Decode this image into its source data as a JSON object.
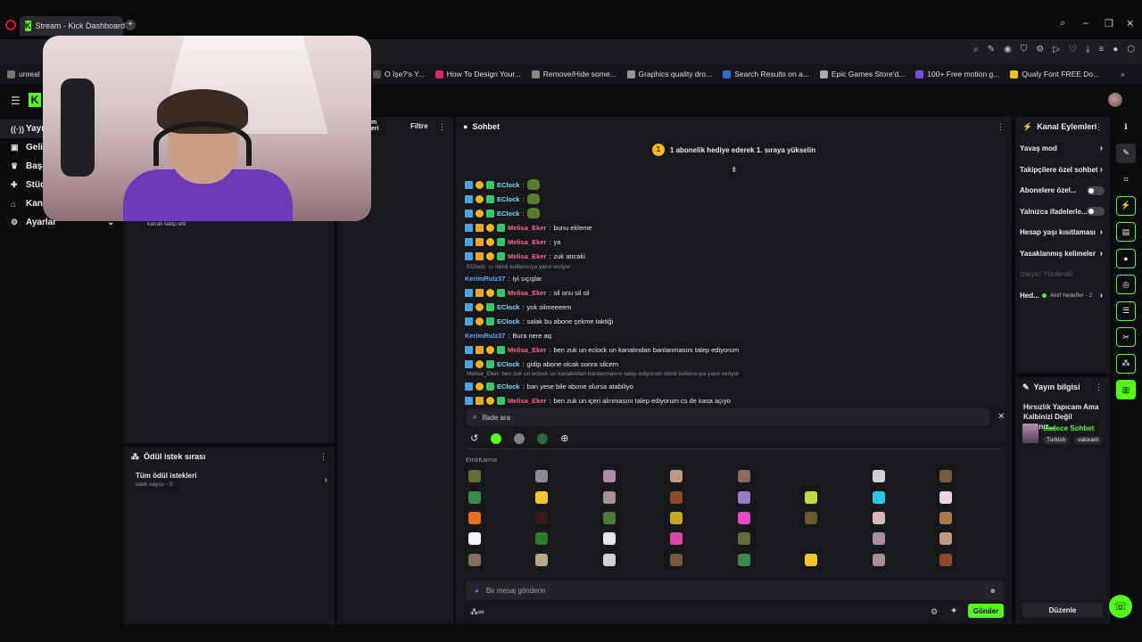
{
  "browser": {
    "tab_title": "Stream - Kick Dashboard",
    "bookmarks_left": "unreal",
    "bookmarks": [
      {
        "label": "O İşe?'s Y...",
        "color": "#555"
      },
      {
        "label": "How To Design Your...",
        "color": "#e0245e"
      },
      {
        "label": "Remove/Hide some...",
        "color": "#888"
      },
      {
        "label": "Graphics quality dro...",
        "color": "#999"
      },
      {
        "label": "Search Results on a...",
        "color": "#2a6fd6"
      },
      {
        "label": "Epic Games Store'd...",
        "color": "#aaa"
      },
      {
        "label": "100+ Free motion g...",
        "color": "#7b4ae2"
      },
      {
        "label": "Qualy Font FREE Do...",
        "color": "#f2c400"
      }
    ]
  },
  "nav": {
    "items": [
      "Yayın",
      "Gelir",
      "Başa",
      "Stüd",
      "Kanal",
      "Ayarlar"
    ]
  },
  "panels": {
    "left_stub_header": "m\neri",
    "filter_label": "Filtre",
    "follow_text": "kanalı takip etti",
    "reward_queue_title": "Ödül istek sırası",
    "reward_all_title": "Tüm ödül istekleri",
    "reward_all_sub": "istek sayısı - 0"
  },
  "chat": {
    "title": "Sohbet",
    "promo_count": "1",
    "promo_text": "1 abonelik hediye ederek 1. sıraya yükselin",
    "messages": [
      {
        "kind": "msg",
        "badges": [
          "b",
          "y",
          "g"
        ],
        "user": "EClock",
        "color": "#7ad7ff",
        "text": "",
        "emote": true
      },
      {
        "kind": "msg",
        "badges": [
          "b",
          "y",
          "g"
        ],
        "user": "EClock",
        "color": "#7ad7ff",
        "text": "",
        "emote": true
      },
      {
        "kind": "msg",
        "badges": [
          "b",
          "y",
          "g"
        ],
        "user": "EClock",
        "color": "#7ad7ff",
        "text": "",
        "emote": true
      },
      {
        "kind": "msg",
        "badges": [
          "b",
          "c",
          "y",
          "g"
        ],
        "user": "Melisa_Eker",
        "color": "#ff5f8f",
        "text": "bunu ekleme"
      },
      {
        "kind": "msg",
        "badges": [
          "b",
          "c",
          "y",
          "g"
        ],
        "user": "Melisa_Eker",
        "color": "#ff5f8f",
        "text": "ya"
      },
      {
        "kind": "msg",
        "badges": [
          "b",
          "c",
          "y",
          "g"
        ],
        "user": "Melisa_Eker",
        "color": "#ff5f8f",
        "text": "zuk atıcaki"
      },
      {
        "kind": "reply",
        "text": "EClock: ▭ isimli kullanıcıya yanıt veriyor"
      },
      {
        "kind": "msg",
        "badges": [],
        "user": "KerimRulz37",
        "color": "#5ea3ff",
        "text": "iyi sıçışlar"
      },
      {
        "kind": "msg",
        "badges": [
          "b",
          "c",
          "y",
          "g"
        ],
        "user": "Melisa_Eker",
        "color": "#ff5f8f",
        "text": "sil onu sil sil"
      },
      {
        "kind": "msg",
        "badges": [
          "b",
          "y",
          "g"
        ],
        "user": "EClock",
        "color": "#7ad7ff",
        "text": "yok silmeeeem"
      },
      {
        "kind": "msg",
        "badges": [
          "b",
          "y",
          "g"
        ],
        "user": "EClock",
        "color": "#7ad7ff",
        "text": "salak bu abone çekme taktiği"
      },
      {
        "kind": "msg",
        "badges": [],
        "user": "KerimRulz37",
        "color": "#5ea3ff",
        "text": "Bura nere aq"
      },
      {
        "kind": "msg",
        "badges": [
          "b",
          "c",
          "y",
          "g"
        ],
        "user": "Melisa_Eker",
        "color": "#ff5f8f",
        "text": "ben zuk un eclock un kanalından banlanmasını talep ediyorum"
      },
      {
        "kind": "msg",
        "badges": [
          "b",
          "y",
          "g"
        ],
        "user": "EClock",
        "color": "#7ad7ff",
        "text": "gidip abone olcak sonra silcem"
      },
      {
        "kind": "reply",
        "text": "Melisa_Eker: ben zuk un eclock un kanalından banlanmasını talep ediyorum isimli kullanıcıya yanıt veriyor"
      },
      {
        "kind": "msg",
        "badges": [
          "b",
          "y",
          "g"
        ],
        "user": "EClock",
        "color": "#7ad7ff",
        "text": "ban yese bile abone olursa atabiliyo"
      },
      {
        "kind": "msg",
        "badges": [
          "b",
          "c",
          "y",
          "g"
        ],
        "user": "Melisa_Eker",
        "color": "#ff5f8f",
        "text": "ben zuk un içeri alınmasını talep ediyorum cs de kasa açıyo"
      }
    ],
    "emote_search_placeholder": "İfade ara",
    "emote_owner": "EmirKarma",
    "message_placeholder": "Bir mesaj gönderin",
    "send_label": "Gönder"
  },
  "channel_actions": {
    "title": "Kanal Eylemleri",
    "items": [
      {
        "label": "Yavaş mod",
        "type": "chevron"
      },
      {
        "label": "Takipçilere özel sohbet",
        "type": "chevron"
      },
      {
        "label": "Abonelere özel...",
        "type": "toggle"
      },
      {
        "label": "Yalnızca ifadelerle...",
        "type": "toggle"
      },
      {
        "label": "Hesap yaşı kısıtlaması",
        "type": "chevron"
      },
      {
        "label": "Yasaklanmış kelimeler",
        "type": "chevron"
      },
      {
        "label": "İzleyici Yönlendir",
        "type": "muted"
      },
      {
        "label": "Hed...",
        "type": "goal",
        "extra": "Aktif hedefler - 2"
      }
    ]
  },
  "stream_info": {
    "title": "Yayın bilgisi",
    "stream_title": "Hırsızlık Yapıcam Ama Kalbinizi Değil Paranız...",
    "category": "Sadece Sohbet",
    "tags": [
      "Turkish",
      "valorant"
    ],
    "edit_label": "Düzenle"
  }
}
